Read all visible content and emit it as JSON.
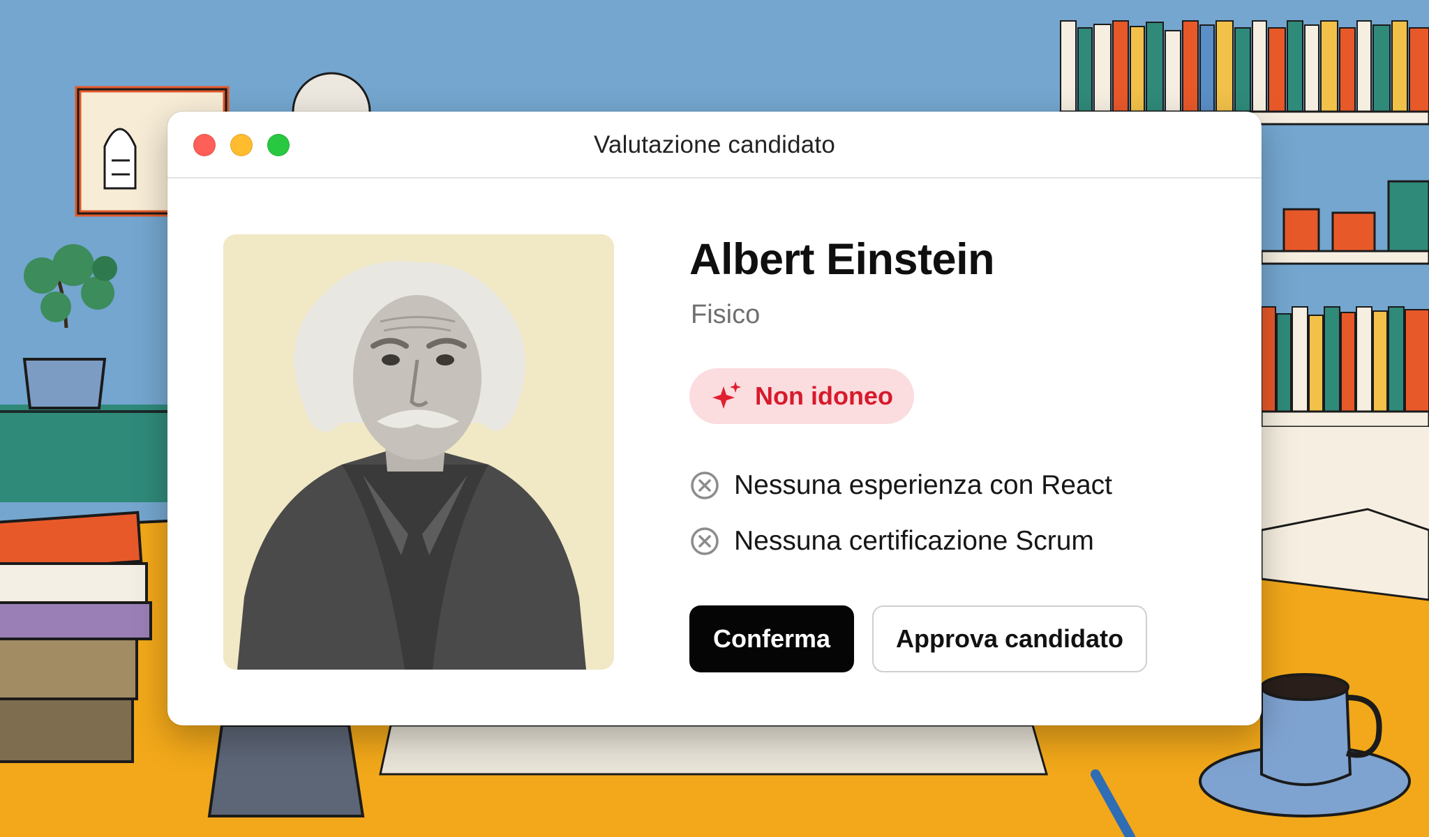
{
  "window": {
    "title": "Valutazione candidato"
  },
  "candidate": {
    "name": "Albert Einstein",
    "role": "Fisico",
    "photo": "candidate-portrait"
  },
  "status": {
    "label": "Non idoneo",
    "icon": "sparkle-icon",
    "color": "#d71a2b",
    "background": "#fbdcdf"
  },
  "reasons": [
    {
      "icon": "x-circle-icon",
      "text": "Nessuna esperienza con React"
    },
    {
      "icon": "x-circle-icon",
      "text": "Nessuna certificazione Scrum"
    }
  ],
  "actions": {
    "confirm_label": "Conferma",
    "approve_label": "Approva candidato"
  },
  "colors": {
    "traffic_close": "#fe5f57",
    "traffic_minimize": "#febc2e",
    "traffic_maximize": "#28c840",
    "primary_button": "#050505"
  }
}
